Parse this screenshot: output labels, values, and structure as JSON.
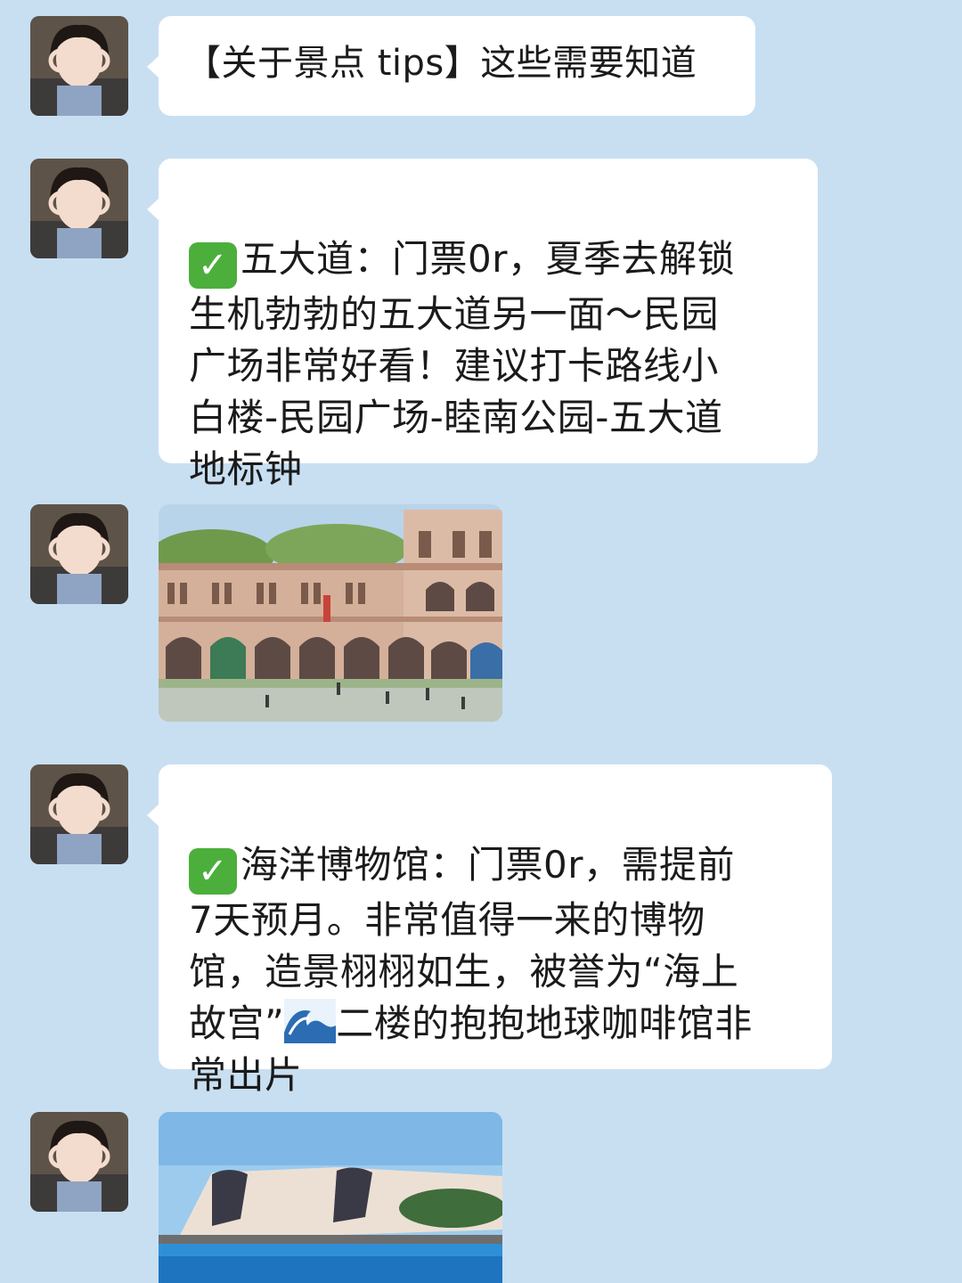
{
  "chat": {
    "messages": [
      {
        "type": "text",
        "text": "【关于景点 tips】这些需要知道"
      },
      {
        "type": "text",
        "check_icon": "check-mark-icon",
        "text": "五大道：门票0r，夏季去解锁\n生机勃勃的五大道另一面～民园\n广场非常好看！建议打卡路线小\n白楼-民园广场-睦南公园-五大道\n地标钟"
      },
      {
        "type": "image",
        "subject": "arched-building-photo"
      },
      {
        "type": "text",
        "check_icon": "check-mark-icon",
        "text_a": "海洋博物馆：门票0r，需提前\n7天预月。非常值得一来的博物\n馆，造景栩栩如生，被誉为“海上\n故宫”",
        "wave_icon": "ocean-wave-icon",
        "text_b": "二楼的抱抱地球咖啡馆非\n常出片"
      },
      {
        "type": "image",
        "subject": "museum-building-photo"
      }
    ]
  },
  "colors": {
    "background": "#c8dff2",
    "bubble": "#ffffff",
    "check": "#4caf3c"
  }
}
